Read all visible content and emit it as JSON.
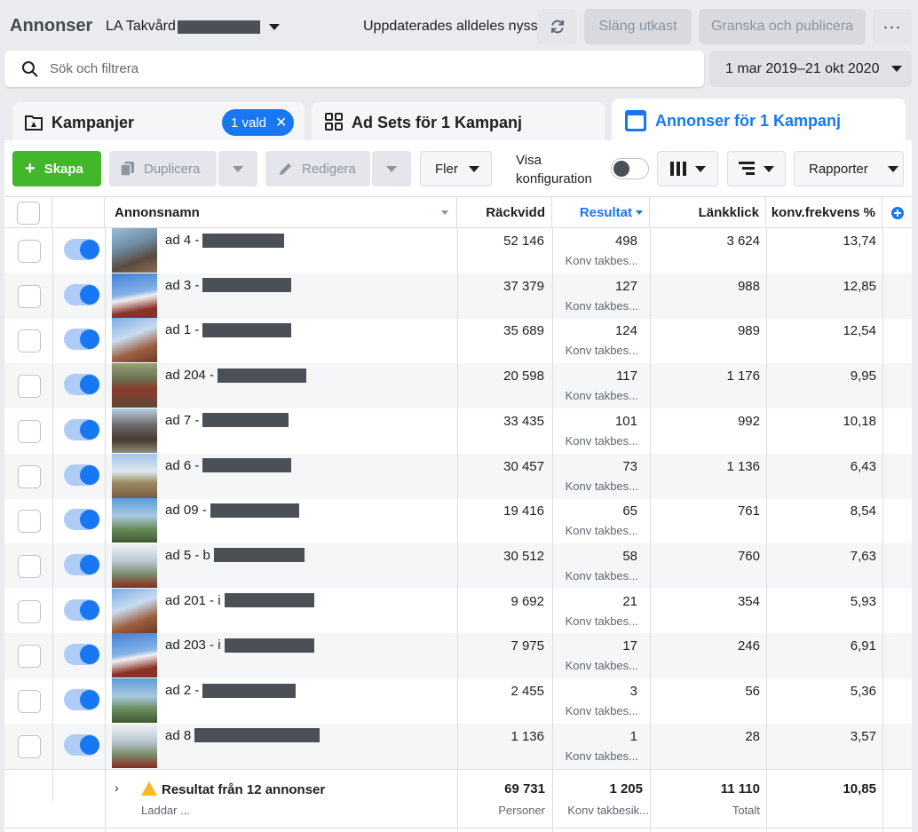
{
  "header": {
    "app_title": "Annonser",
    "account_name": "LA Takvård",
    "updated_text": "Uppdaterades alldeles nyss",
    "discard_label": "Släng utkast",
    "publish_label": "Granska och publicera",
    "more_label": "···"
  },
  "search": {
    "placeholder": "Sök och filtrera",
    "date_range": "1 mar 2019–21 okt 2020"
  },
  "tabs": {
    "campaigns": {
      "label": "Kampanjer",
      "selected_chip": "1 vald",
      "chip_close": "✕"
    },
    "adsets": {
      "label": "Ad Sets för 1 Kampanj"
    },
    "ads": {
      "label": "Annonser för 1 Kampanj"
    }
  },
  "toolbar": {
    "create_label": "Skapa",
    "duplicate_label": "Duplicera",
    "edit_label": "Redigera",
    "more_label": "Fler",
    "show_config_line1": "Visa",
    "show_config_line2": "konfiguration",
    "reports_label": "Rapporter"
  },
  "table": {
    "columns": {
      "name": "Annonsnamn",
      "reach": "Räckvidd",
      "results": "Resultat",
      "link_clicks": "Länkklick",
      "conv_freq": "konv.frekvens %"
    },
    "rows": [
      {
        "name": "ad 4 -",
        "reach": "52 146",
        "results": "498",
        "result_type": "Konv takbes...",
        "link_clicks": "3 624",
        "conv_freq": "13,74"
      },
      {
        "name": "ad 3 -",
        "reach": "37 379",
        "results": "127",
        "result_type": "Konv takbes...",
        "link_clicks": "988",
        "conv_freq": "12,85"
      },
      {
        "name": "ad 1 -",
        "reach": "35 689",
        "results": "124",
        "result_type": "Konv takbes...",
        "link_clicks": "989",
        "conv_freq": "12,54"
      },
      {
        "name": "ad 204 -",
        "reach": "20 598",
        "results": "117",
        "result_type": "Konv takbes...",
        "link_clicks": "1 176",
        "conv_freq": "9,95"
      },
      {
        "name": "ad 7 -",
        "reach": "33 435",
        "results": "101",
        "result_type": "Konv takbes...",
        "link_clicks": "992",
        "conv_freq": "10,18"
      },
      {
        "name": "ad 6 -",
        "reach": "30 457",
        "results": "73",
        "result_type": "Konv takbes...",
        "link_clicks": "1 136",
        "conv_freq": "6,43"
      },
      {
        "name": "ad 09 -",
        "reach": "19 416",
        "results": "65",
        "result_type": "Konv takbes...",
        "link_clicks": "761",
        "conv_freq": "8,54"
      },
      {
        "name": "ad 5 - b",
        "reach": "30 512",
        "results": "58",
        "result_type": "Konv takbes...",
        "link_clicks": "760",
        "conv_freq": "7,63"
      },
      {
        "name": "ad 201 - i",
        "reach": "9 692",
        "results": "21",
        "result_type": "Konv takbes...",
        "link_clicks": "354",
        "conv_freq": "5,93"
      },
      {
        "name": "ad 203 - i",
        "reach": "7 975",
        "results": "17",
        "result_type": "Konv takbes...",
        "link_clicks": "246",
        "conv_freq": "6,91"
      },
      {
        "name": "ad 2 -",
        "reach": "2 455",
        "results": "3",
        "result_type": "Konv takbes...",
        "link_clicks": "56",
        "conv_freq": "5,36"
      },
      {
        "name": "ad 8",
        "reach": "1 136",
        "results": "1",
        "result_type": "Konv takbes...",
        "link_clicks": "28",
        "conv_freq": "3,57"
      }
    ],
    "summary": {
      "label": "Resultat från 12 annonser",
      "status": "Laddar ...",
      "reach": "69 731",
      "reach_unit": "Personer",
      "results": "1 205",
      "results_unit": "Konv takbesik...",
      "link_clicks": "11 110",
      "link_clicks_unit": "Totalt",
      "conv_freq": "10,85"
    }
  }
}
